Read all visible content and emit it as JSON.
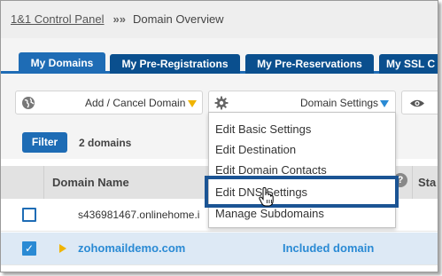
{
  "breadcrumb": {
    "root": "1&1 Control Panel",
    "separator": "»»",
    "current": "Domain Overview"
  },
  "tabs": [
    {
      "label": "My Domains",
      "active": true
    },
    {
      "label": "My Pre-Registrations",
      "active": false
    },
    {
      "label": "My Pre-Reservations",
      "active": false
    },
    {
      "label": "My SSL C",
      "active": false
    }
  ],
  "toolbar": {
    "add_cancel_label": "Add / Cancel Domain",
    "domain_settings_label": "Domain Settings",
    "globe_icon": "globe-icon",
    "gear_icon": "gear-icon",
    "eye_icon": "eye-icon"
  },
  "filter": {
    "button_label": "Filter",
    "count_label": "2 domains"
  },
  "table": {
    "columns": [
      "Domain Name",
      "Sta"
    ],
    "rows": [
      {
        "domain": "s436981467.onlinehome.i",
        "usage": "",
        "checked": false,
        "expandable": false
      },
      {
        "domain": "zohomaildemo.com",
        "usage": "Included domain",
        "checked": true,
        "expandable": true
      }
    ]
  },
  "dropdown_menu": {
    "items": [
      "Edit Basic Settings",
      "Edit Destination",
      "Edit Domain Contacts",
      "Edit DNS Settings",
      "Manage Subdomains"
    ],
    "highlighted_index": 3
  },
  "colors": {
    "brand_dark": "#0a4f8e",
    "brand": "#1e6cb5",
    "link": "#2a8ad4",
    "accent_arrow": "#f0b400",
    "highlight_box": "#1b5494"
  }
}
